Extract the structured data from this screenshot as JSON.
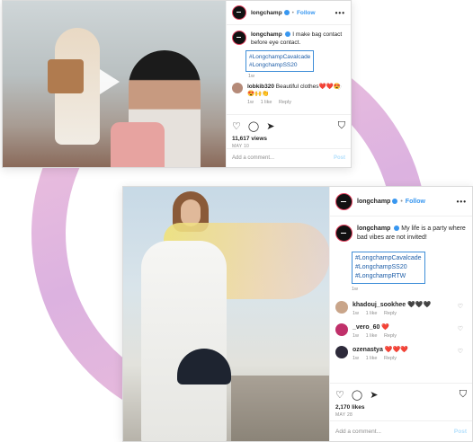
{
  "colors": {
    "accent": "#3897f0",
    "highlight_box": "#3f8ed8",
    "heart": "#e0245e",
    "ring": "#dcb2e0"
  },
  "post1": {
    "header": {
      "username": "longchamp",
      "follow": "Follow",
      "more": "•••"
    },
    "caption": {
      "username": "longchamp",
      "text": "I make bag contact before eye contact.",
      "hashtags": [
        "#LongchampCavalcade",
        "#LongchampSS20"
      ],
      "age": "1w"
    },
    "comments": [
      {
        "username": "lobkib320",
        "text": "Beautiful clothes❤️❤️😍😍🙌👏",
        "time": "1w",
        "likes": "1 like",
        "reply": "Reply"
      }
    ],
    "likes": "11,617 views",
    "date": "MAY 10",
    "add_comment_placeholder": "Add a comment...",
    "post_label": "Post"
  },
  "post2": {
    "header": {
      "username": "longchamp",
      "follow": "Follow",
      "more": "•••"
    },
    "caption": {
      "username": "longchamp",
      "text": "My life is a party where bad vibes are not invited!",
      "hashtags": [
        "#LongchampCavalcade",
        "#LongchampSS20",
        "#LongchampRTW"
      ],
      "age": "1w"
    },
    "comments": [
      {
        "username": "khadouj_sookhee",
        "text": "🖤🖤🖤",
        "time": "1w",
        "likes": "1 like",
        "reply": "Reply"
      },
      {
        "username": "_vero_60",
        "text": "❤️",
        "time": "1w",
        "likes": "1 like",
        "reply": "Reply"
      },
      {
        "username": "ozenastya",
        "text": "❤️❤️❤️",
        "time": "1w",
        "likes": "1 like",
        "reply": "Reply"
      }
    ],
    "likes": "2,170 likes",
    "date": "MAY 28",
    "add_comment_placeholder": "Add a comment...",
    "post_label": "Post"
  }
}
